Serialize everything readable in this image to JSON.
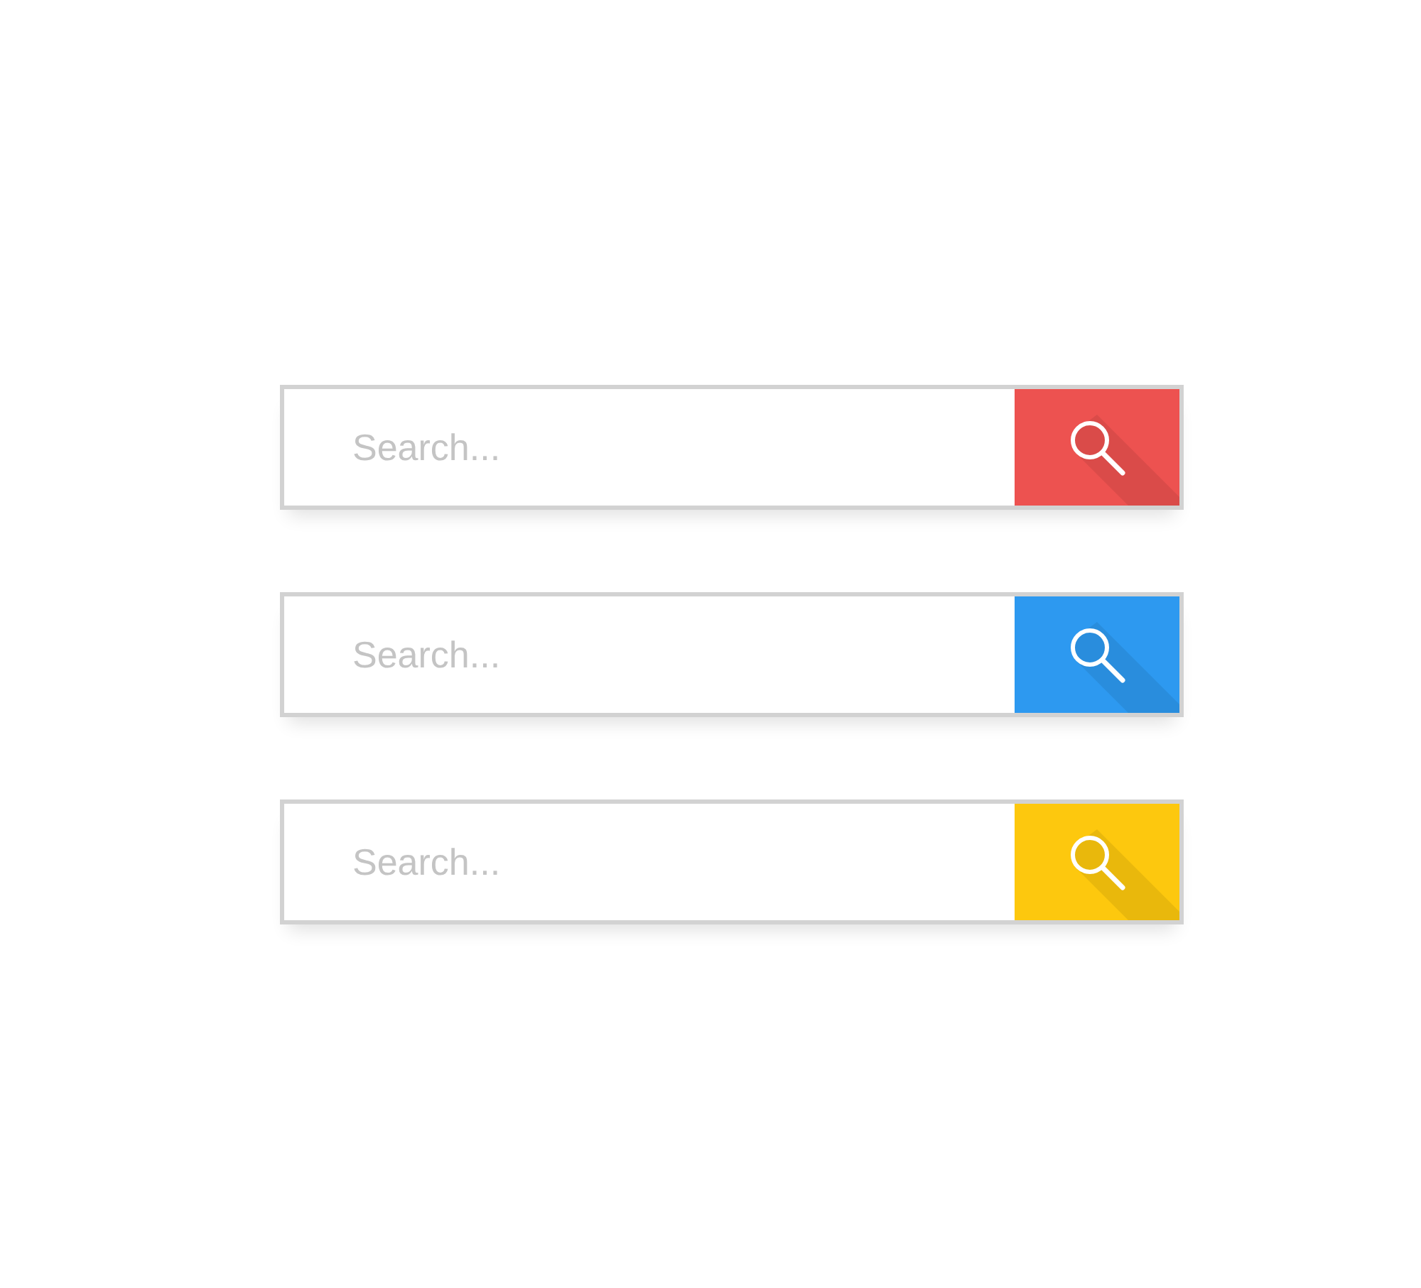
{
  "search_bars": [
    {
      "placeholder": "Search...",
      "color": "#ed5250"
    },
    {
      "placeholder": "Search...",
      "color": "#2d99f0"
    },
    {
      "placeholder": "Search...",
      "color": "#fdc80e"
    }
  ]
}
